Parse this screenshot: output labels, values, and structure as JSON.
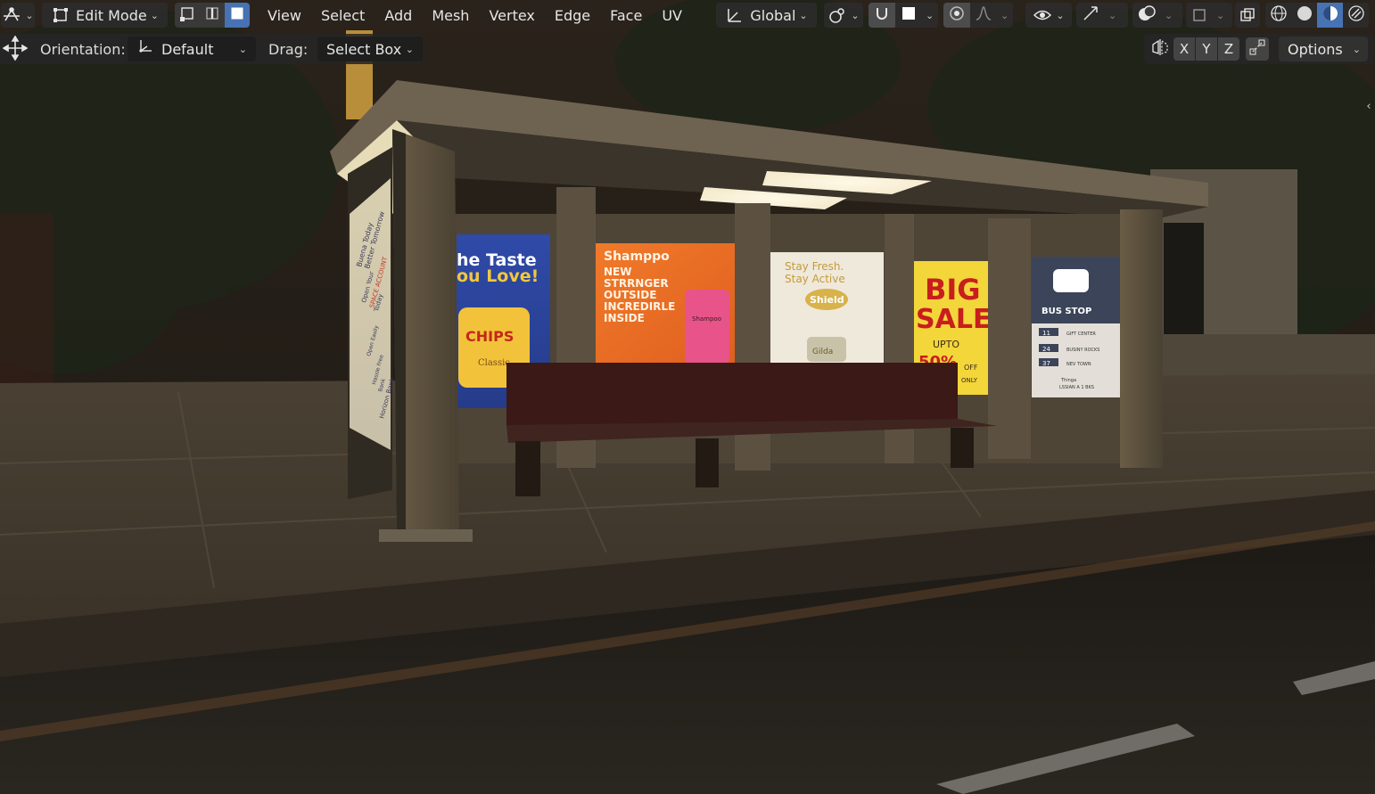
{
  "header": {
    "editor_type_icon": "editor-type-icon",
    "mode": {
      "label": "Edit Mode",
      "icon": "edit-mode-icon"
    },
    "select_modes": [
      {
        "name": "vertex-select-icon",
        "active": false
      },
      {
        "name": "edge-select-icon",
        "active": false
      },
      {
        "name": "face-select-icon",
        "active": true
      }
    ],
    "menus": [
      "View",
      "Select",
      "Add",
      "Mesh",
      "Vertex",
      "Edge",
      "Face",
      "UV"
    ],
    "transform_orientation": {
      "label": "Global",
      "icon": "transform-orientation-icon"
    },
    "pivot_icon": "pivot-point-icon",
    "snap_icon": "snap-magnet-icon",
    "snap_target_icon": "snap-target-icon",
    "proportional_icon": "proportional-editing-icon",
    "falloff_icon": "falloff-curve-icon",
    "visibility_icon": "eye-icon",
    "gizmo_icon": "gizmo-icon",
    "overlay_icon": "overlay-icon",
    "xray_icon": "xray-icon",
    "shading_modes": [
      {
        "name": "wireframe-shading-icon",
        "active": false
      },
      {
        "name": "solid-shading-icon",
        "active": false
      },
      {
        "name": "material-preview-shading-icon",
        "active": true
      },
      {
        "name": "rendered-shading-icon",
        "active": false
      }
    ]
  },
  "tool_settings": {
    "move_icon": "move-icon",
    "orientation_label": "Orientation:",
    "orientation_value": "Default",
    "drag_label": "Drag:",
    "drag_value": "Select Box",
    "mirror_icon": "mirror-icon",
    "axes": [
      "X",
      "Y",
      "Z"
    ],
    "auto_merge_icon": "auto-merge-icon",
    "options_label": "Options"
  },
  "accent_color": "#4772b3",
  "scene": {
    "posters": [
      {
        "line1": "he Taste",
        "line2": "ou Love!",
        "badge": "CHIPS",
        "sub": "Classic"
      },
      {
        "title": "Shamppo",
        "lines": [
          "NEW",
          "STRRNGER",
          "OUTSIDE",
          "INCREDIRLE",
          "INSIDE"
        ],
        "bottle": "Shampoo"
      },
      {
        "line1": "Stay Fresh.",
        "line2": "Stay Active",
        "badge": "Shield",
        "bottle": "Gilda"
      },
      {
        "line1": "BIG",
        "line2": "SALE",
        "line3": "UPTO",
        "line4": "50%",
        "line5": "OFF",
        "line6": "ONLY"
      },
      {
        "title": "BUS STOP",
        "routes": [
          {
            "num": "11",
            "dest": "GIFT CENTER"
          },
          {
            "num": "24",
            "dest": "BUSINY ROCKS"
          },
          {
            "num": "37",
            "dest": "NEV TOWN"
          }
        ],
        "footer1": "Thinga",
        "footer2": "LSSIAN A 1 BKS"
      }
    ],
    "side_ad": [
      "Buena Today",
      "Better Tomorrow",
      "Open Your",
      "SPACE ACCOUNT",
      "Today",
      "Open Easily",
      "Hassle Free",
      "Bank",
      "Horizon Bank"
    ]
  }
}
